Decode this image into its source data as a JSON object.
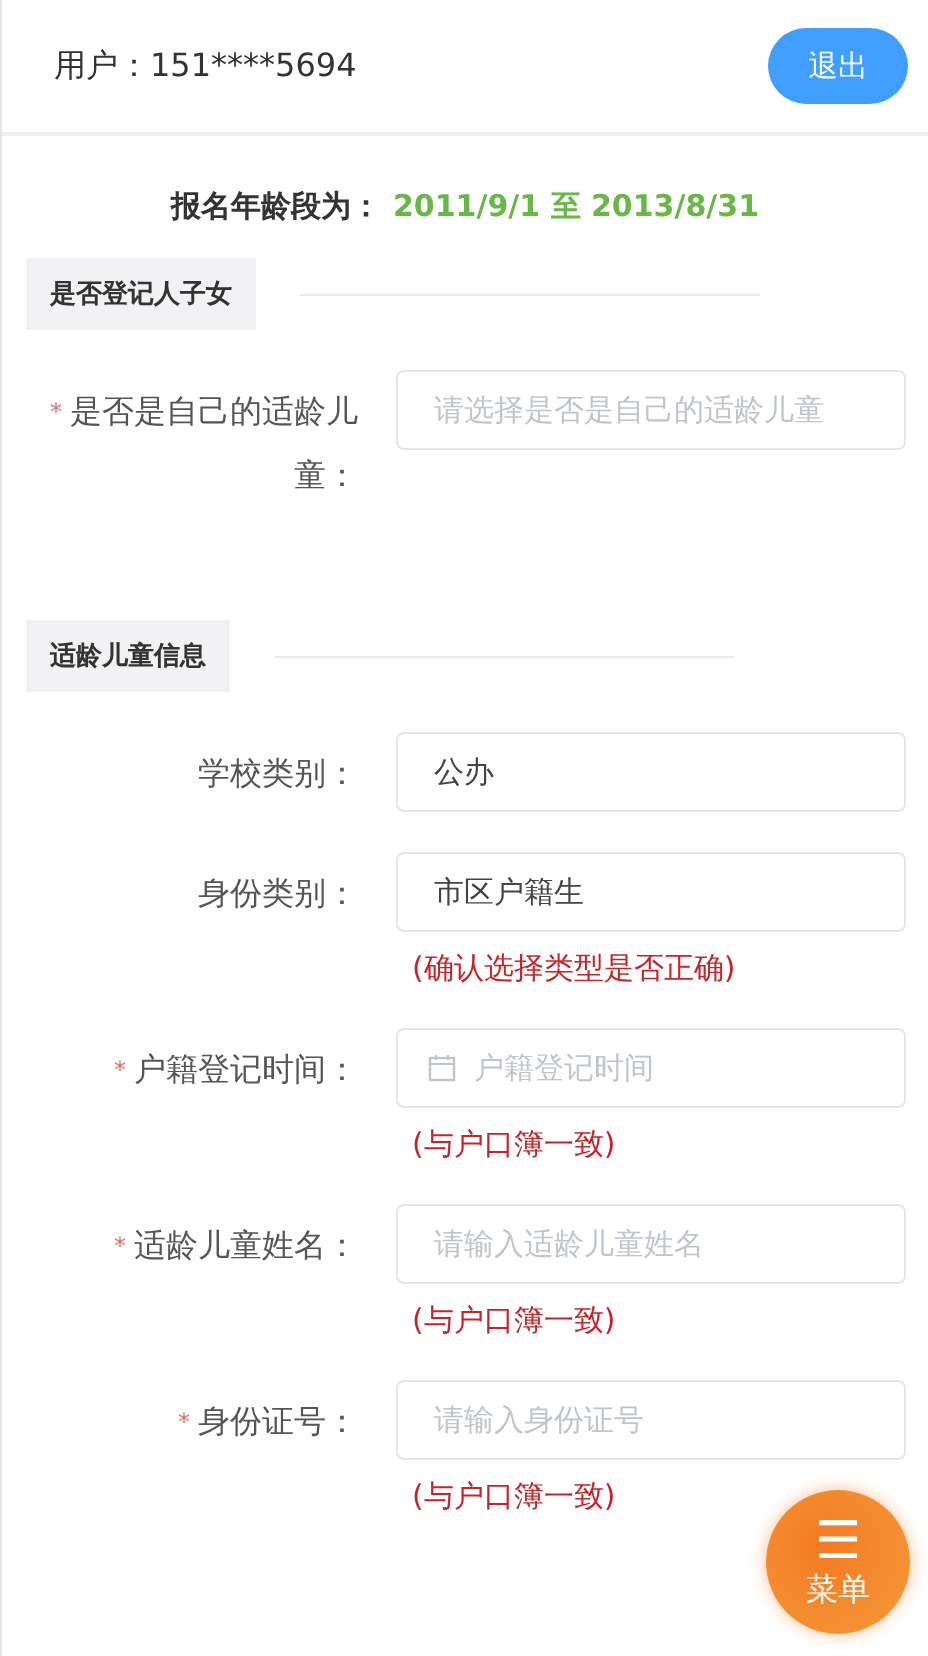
{
  "header": {
    "user_label": "用户：151****5694",
    "logout_button": "退出"
  },
  "age_range": {
    "label": "报名年龄段为：",
    "value": "2011/9/1 至 2013/8/31"
  },
  "sections": [
    {
      "title": "是否登记人子女",
      "fields": [
        {
          "kind": "select",
          "required_mark": "*",
          "label": "是否是自己的适龄儿童：",
          "placeholder": "请选择是否是自己的适龄儿童"
        }
      ]
    },
    {
      "title": "适龄儿童信息",
      "fields": [
        {
          "kind": "select",
          "label": "学校类别：",
          "value": "公办"
        },
        {
          "kind": "select",
          "label": "身份类别：",
          "value": "市区户籍生",
          "hint": "(确认选择类型是否正确)"
        },
        {
          "kind": "date",
          "required_mark": "*",
          "label": "户籍登记时间：",
          "placeholder": "户籍登记时间",
          "hint": "(与户口簿一致)"
        },
        {
          "kind": "input",
          "required_mark": "*",
          "label": "适龄儿童姓名：",
          "placeholder": "请输入适龄儿童姓名",
          "hint": "(与户口簿一致)"
        },
        {
          "kind": "input",
          "required_mark": "*",
          "label": "身份证号：",
          "placeholder": "请输入身份证号",
          "hint": "(与户口簿一致)"
        }
      ]
    }
  ],
  "menu_button": {
    "icon": "☰",
    "label": "菜单"
  }
}
